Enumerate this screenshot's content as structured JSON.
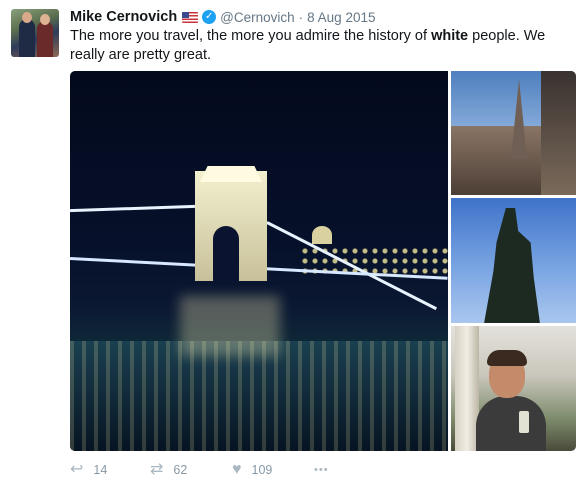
{
  "tweet": {
    "display_name": "Mike Cernovich",
    "handle": "@Cernovich",
    "separator": "·",
    "date": "8 Aug 2015",
    "text_before": "The more you travel, the more you admire the history of ",
    "text_bold": "white",
    "text_after": " people. We really are pretty great."
  },
  "actions": {
    "reply_count": "14",
    "retweet_count": "62",
    "like_count": "109",
    "more_label": "•••"
  },
  "icons": {
    "flag": "us-flag-icon",
    "verified": "verified-badge-icon",
    "reply": "reply-icon",
    "retweet": "retweet-icon",
    "like": "heart-icon",
    "more": "more-icon"
  },
  "colors": {
    "verified_blue": "#1da1f2",
    "action_gray": "#aab8c2",
    "meta_gray": "#657786"
  }
}
